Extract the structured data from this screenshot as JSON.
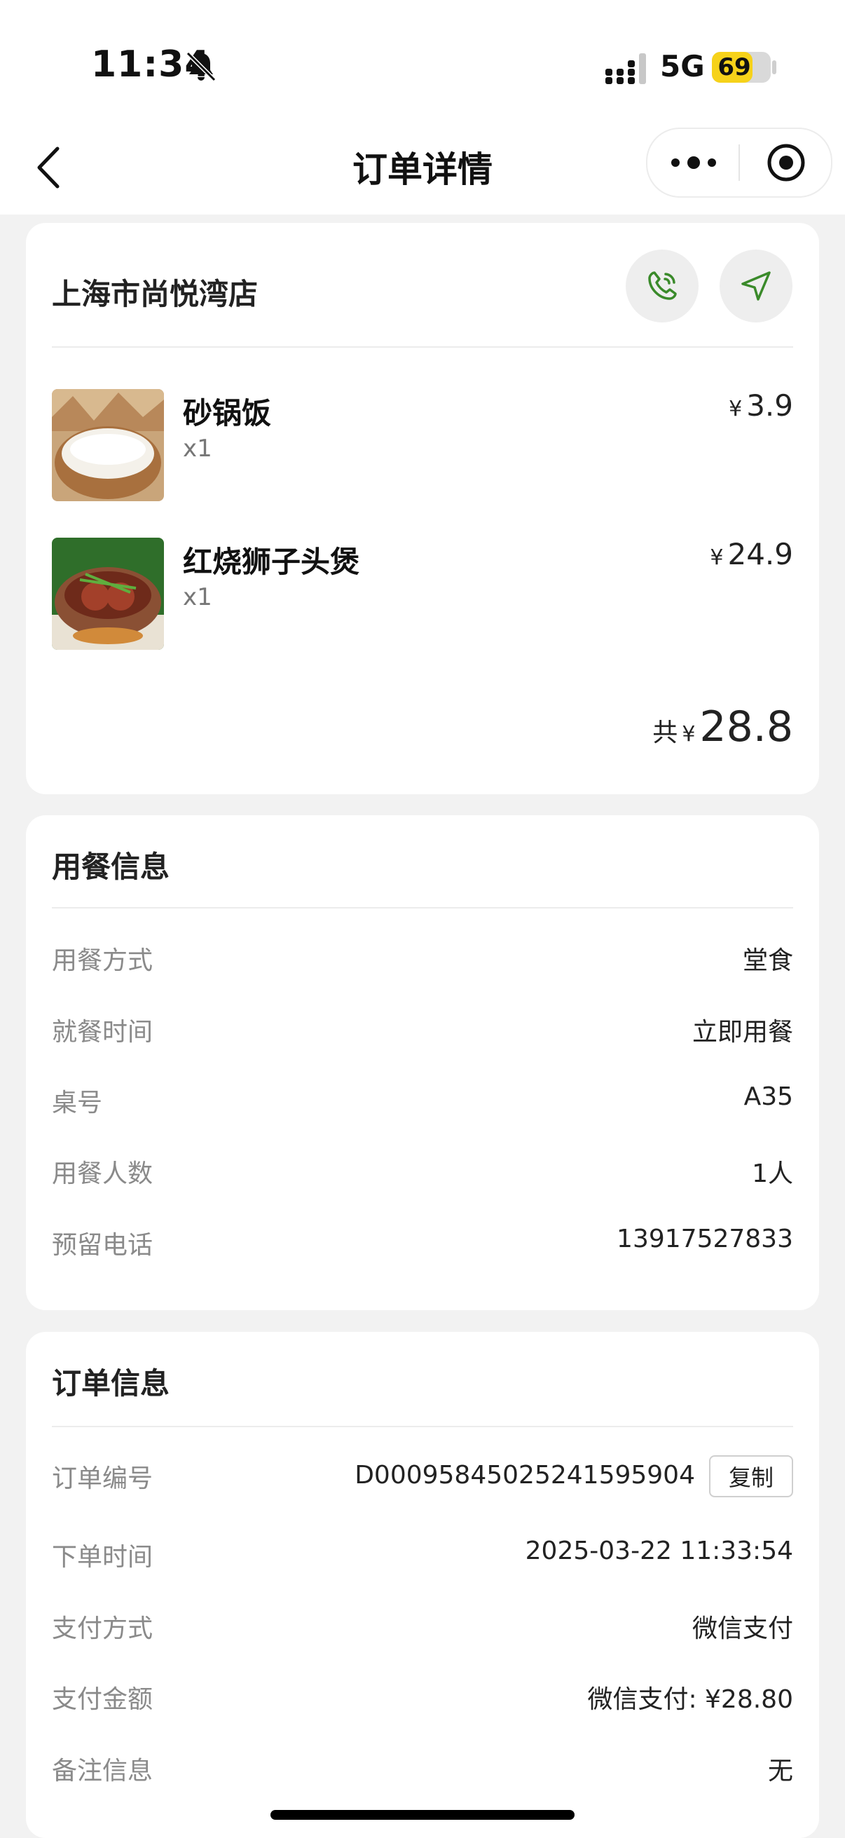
{
  "status_bar": {
    "time": "11:34",
    "network": "5G",
    "battery": "69",
    "battery_level": 0.69
  },
  "navbar": {
    "title": "订单详情"
  },
  "store": {
    "name": "上海市尚悦湾店"
  },
  "items": [
    {
      "name": "砂锅饭",
      "qty": "x1",
      "currency": "¥",
      "price": "3.9"
    },
    {
      "name": "红烧狮子头煲",
      "qty": "x1",
      "currency": "¥",
      "price": "24.9"
    }
  ],
  "total": {
    "label": "共",
    "currency": "¥",
    "amount": "28.8"
  },
  "dining": {
    "title": "用餐信息",
    "rows": [
      {
        "label": "用餐方式",
        "value": "堂食"
      },
      {
        "label": "就餐时间",
        "value": "立即用餐"
      },
      {
        "label": "桌号",
        "value": "A35"
      },
      {
        "label": "用餐人数",
        "value": "1人"
      },
      {
        "label": "预留电话",
        "value": "13917527833"
      }
    ]
  },
  "order": {
    "title": "订单信息",
    "copy_label": "复制",
    "rows": [
      {
        "label": "订单编号",
        "value": "D000958450252415959​04"
      },
      {
        "label": "下单时间",
        "value": "2025-03-22 11:33:54"
      },
      {
        "label": "支付方式",
        "value": "微信支付"
      },
      {
        "label": "支付金额",
        "value": "微信支付: ¥28.80"
      },
      {
        "label": "备注信息",
        "value": "无"
      }
    ]
  },
  "colors": {
    "accent_green": "#3a8a2a",
    "battery_yellow": "#f6d21a",
    "background": "#f2f2f2"
  }
}
